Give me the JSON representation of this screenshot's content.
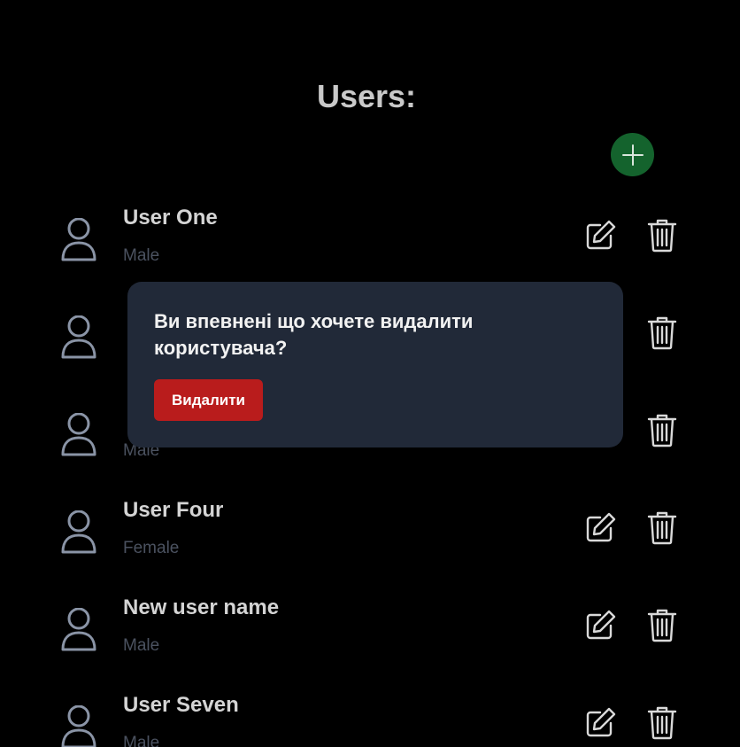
{
  "header": {
    "title": "Users:"
  },
  "colors": {
    "background": "#000000",
    "add_button": "#14632d",
    "popover_bg": "#212938",
    "danger": "#b91c1c",
    "name_text": "#d4d4d4",
    "gender_text": "#4b5260",
    "icon": "#d9d9d9",
    "avatar": "#8a94a6"
  },
  "icons": {
    "add": "plus-icon",
    "avatar": "user-icon",
    "edit": "pencil-square-icon",
    "delete": "trash-icon"
  },
  "users": [
    {
      "name": "User One",
      "gender": "Male"
    },
    {
      "name": "",
      "gender": ""
    },
    {
      "name": "",
      "gender": "Male"
    },
    {
      "name": "User Four",
      "gender": "Female"
    },
    {
      "name": "New user name",
      "gender": "Male"
    },
    {
      "name": "User Seven",
      "gender": "Male"
    }
  ],
  "confirm_dialog": {
    "message": "Ви впевнені що хочете видалити користувача?",
    "confirm_label": "Видалити"
  }
}
